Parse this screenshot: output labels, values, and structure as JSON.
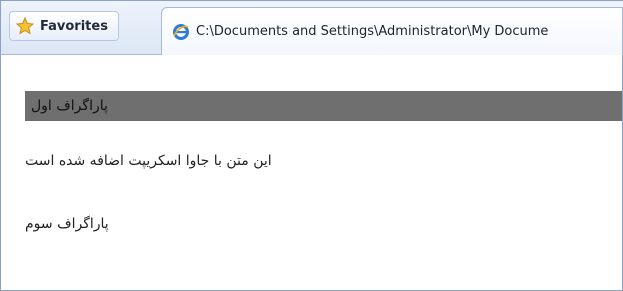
{
  "toolbar": {
    "favorites_label": "Favorites",
    "tab_title": "C:\\Documents and Settings\\Administrator\\My Docume"
  },
  "content": {
    "paragraph_1": "پاراگراف اول",
    "paragraph_2": "این متن با جاوا اسکریپت اضافه شده است",
    "paragraph_3": "پاراگراف سوم"
  },
  "colors": {
    "highlight_background": "#6f6f6f",
    "toolbar_background": "#dbe6f5"
  },
  "icons": {
    "favorites": "star-icon",
    "tab": "ie-icon"
  }
}
